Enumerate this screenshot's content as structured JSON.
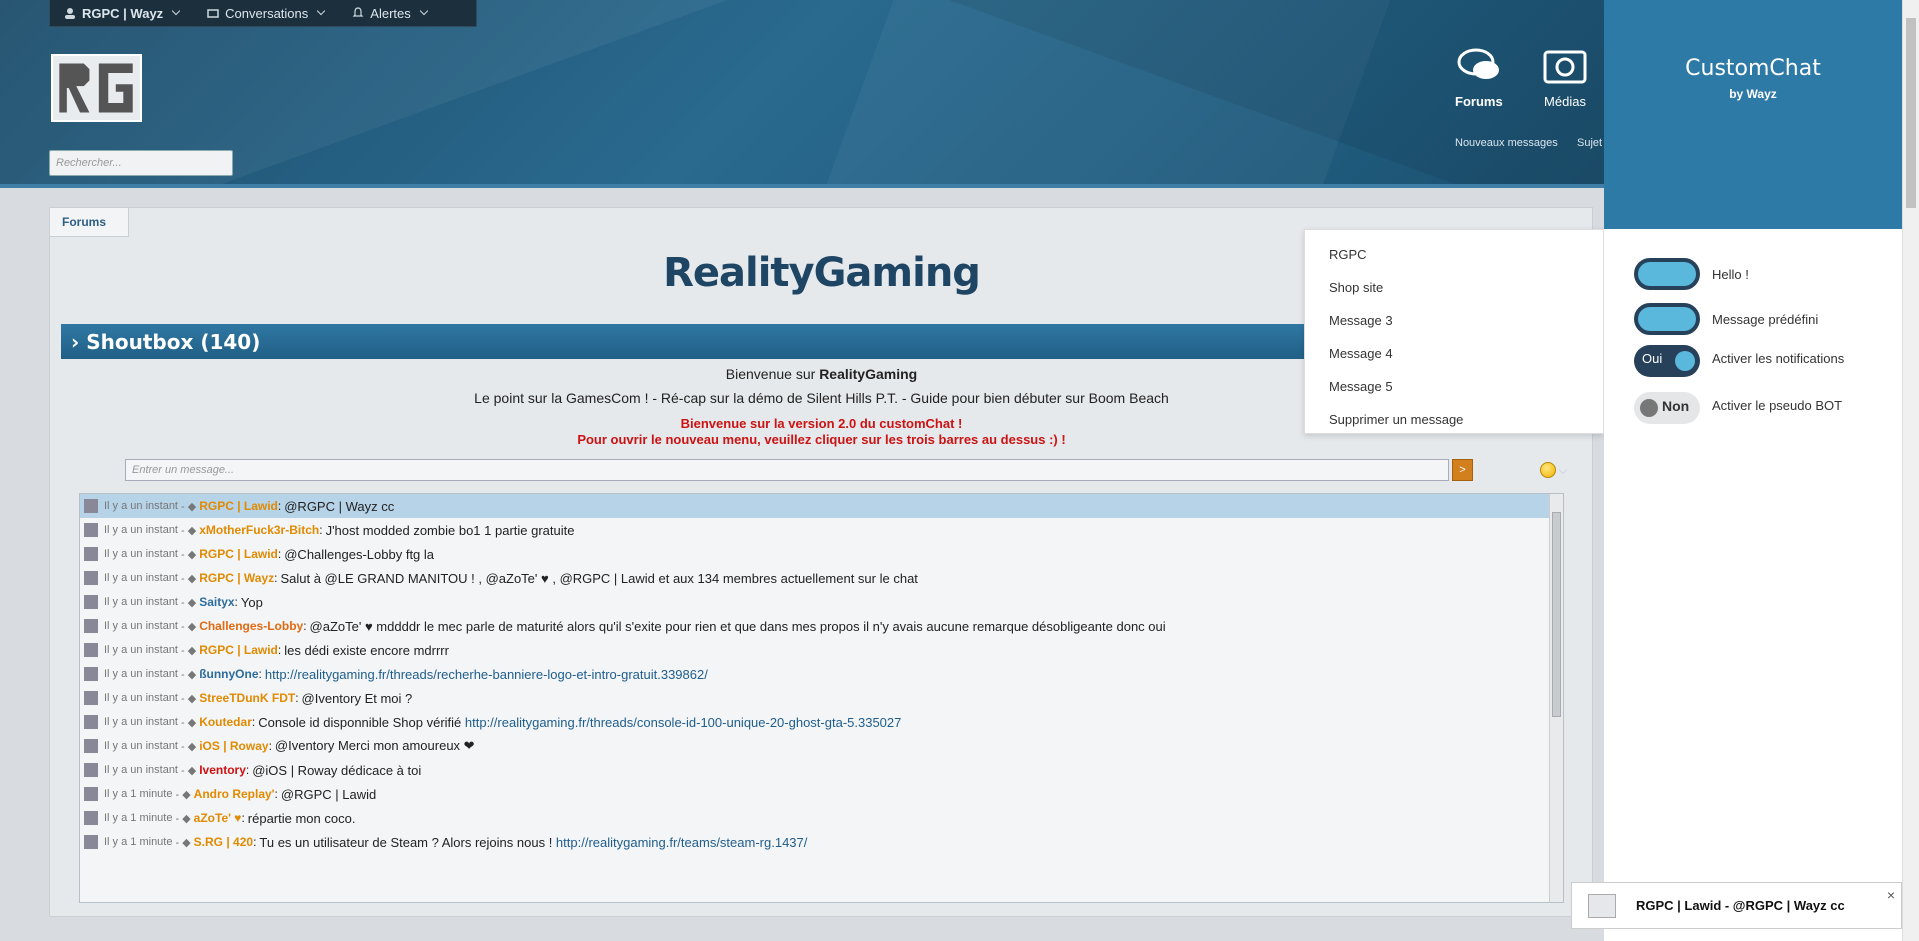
{
  "topbar": {
    "user": "RGPC | Wayz",
    "conversations": "Conversations",
    "alerts": "Alertes"
  },
  "search": {
    "placeholder": "Rechercher..."
  },
  "nav": {
    "forums": "Forums",
    "medias": "Médias",
    "sub1": "Nouveaux messages",
    "sub2": "Sujet"
  },
  "breadcrumb": "Forums",
  "site_title": "RealityGaming",
  "shoutbox": {
    "title": "Shoutbox (140)",
    "welcome": "Bienvenue sur ",
    "welcome_bold": "RealityGaming",
    "line2": "Le point sur la GamesCom ! - Ré-cap sur la démo de Silent Hills P.T. - Guide pour bien débuter sur Boom Beach",
    "red1": "Bienvenue sur la version 2.0 du customChat !",
    "red2": "Pour ouvrir le nouveau menu, veuillez cliquer sur les trois barres au dessus :) !",
    "input_placeholder": "Entrer un message...",
    "send": ">"
  },
  "messages": [
    {
      "time": "Il y a un instant",
      "user": "RGPC | Lawid",
      "user_color": "#e28a00",
      "text": "@RGPC | Wayz cc",
      "link": ""
    },
    {
      "time": "Il y a un instant",
      "user": "xMotherFuck3r-Bitch",
      "user_color": "#e28a00",
      "text": "J'host modded zombie bo1 1 partie gratuite",
      "link": ""
    },
    {
      "time": "Il y a un instant",
      "user": "RGPC | Lawid",
      "user_color": "#e28a00",
      "text": "@Challenges-Lobby ftg la",
      "link": ""
    },
    {
      "time": "Il y a un instant",
      "user": "RGPC | Wayz",
      "user_color": "#e28a00",
      "text": "Salut à @LE GRAND MANITOU ! , @aZoTe' ♥ , @RGPC | Lawid et aux 134 membres actuellement sur le chat",
      "link": ""
    },
    {
      "time": "Il y a un instant",
      "user": "Saityx",
      "user_color": "#2d6c9a",
      "text": "Yop",
      "link": ""
    },
    {
      "time": "Il y a un instant",
      "user": "Challenges-Lobby",
      "user_color": "#e26a10",
      "text": "@aZoTe' ♥ mddddr le mec parle de maturité alors qu'il s'exite pour rien et que dans mes propos il n'y avais aucune remarque désobligeante donc oui",
      "link": ""
    },
    {
      "time": "Il y a un instant",
      "user": "RGPC | Lawid",
      "user_color": "#e28a00",
      "text": "les dédi existe encore mdrrrr",
      "link": ""
    },
    {
      "time": "Il y a un instant",
      "user": "ßunnyOne",
      "user_color": "#2d6c9a",
      "text": "",
      "link": "http://realitygaming.fr/threads/recherhe-banniere-logo-et-intro-gratuit.339862/"
    },
    {
      "time": "Il y a un instant",
      "user": "StreeTDunK FDT",
      "user_color": "#e28a00",
      "text": "@Iventory Et moi ?",
      "link": ""
    },
    {
      "time": "Il y a un instant",
      "user": "Koutedar",
      "user_color": "#e28a00",
      "text": "Console id disponnible   Shop vérifié",
      "link": "http://realitygaming.fr/threads/console-id-100-unique-20-ghost-gta-5.335027"
    },
    {
      "time": "Il y a un instant",
      "user": "iOS | Roway",
      "user_color": "#e28a00",
      "text": "@Iventory Merci mon amoureux ❤",
      "link": ""
    },
    {
      "time": "Il y a un instant",
      "user": "Iventory",
      "user_color": "#d01010",
      "text": "@iOS | Roway dédicace à toi",
      "link": ""
    },
    {
      "time": "Il y a 1 minute",
      "user": "Andro Replay'",
      "user_color": "#e28a00",
      "text": "@RGPC | Lawid",
      "link": ""
    },
    {
      "time": "Il y a 1 minute",
      "user": "aZoTe' ♥",
      "user_color": "#e28a00",
      "text": "répartie mon coco.",
      "link": ""
    },
    {
      "time": "Il y a 1 minute",
      "user": "S.RG | 420",
      "user_color": "#e28a00",
      "text": "Tu es un utilisateur de Steam ? Alors rejoins nous !",
      "link": "http://realitygaming.fr/teams/steam-rg.1437/"
    }
  ],
  "dropdown": [
    "RGPC",
    "Shop site",
    "Message 3",
    "Message 4",
    "Message 5",
    "Supprimer un message"
  ],
  "customchat": {
    "title": "CustomChat",
    "by": "by Wayz",
    "opt1": "Hello !",
    "opt2": "Message prédéfini",
    "opt3": "Activer les notifications",
    "opt4": "Activer le pseudo BOT",
    "oui": "Oui",
    "non": "Non"
  },
  "toast": {
    "text": "RGPC | Lawid - @RGPC | Wayz cc",
    "close": "×"
  }
}
